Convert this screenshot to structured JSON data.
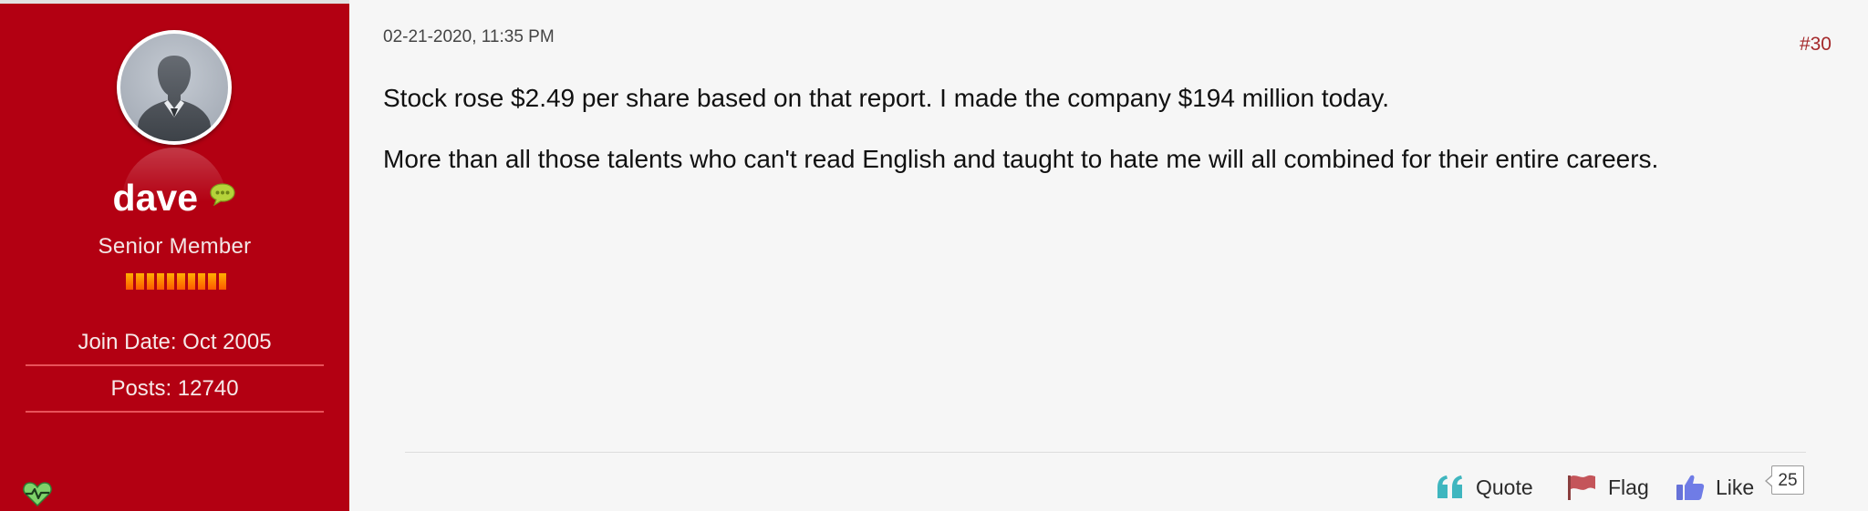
{
  "user": {
    "name": "dave",
    "title": "Senior Member",
    "reputation_bars": 10,
    "join_date": "Join Date: Oct 2005",
    "posts": "Posts: 12740",
    "name_color": "#ffffff",
    "sidebar_color": "#b30012",
    "pm_icon": "chat-bubble-icon",
    "online_icon": "heartbeat-icon"
  },
  "post": {
    "date": "02-21-2020, 11:35 PM",
    "number": "#30",
    "lines": [
      "Stock rose $2.49 per share based on that report. I made the company $194 million today.",
      "More than all those talents who can't read English and taught to hate me will all combined for their entire careers."
    ]
  },
  "actions": {
    "quote": "Quote",
    "flag": "Flag",
    "like": "Like",
    "like_count": "25",
    "quote_icon": "quote-icon",
    "flag_icon": "flag-icon",
    "like_icon": "thumbs-up-icon"
  }
}
